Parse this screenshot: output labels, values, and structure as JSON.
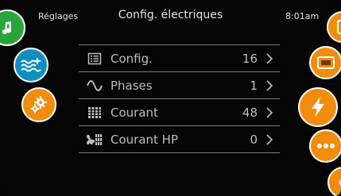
{
  "header": {
    "back_label": "Réglages",
    "title": "Config. électriques",
    "time": "8:01am"
  },
  "menu": {
    "items": [
      {
        "label": "Config.",
        "value": "16",
        "icon": "list-icon"
      },
      {
        "label": "Phases",
        "value": "1",
        "icon": "sine-wave-icon"
      },
      {
        "label": "Courant",
        "value": "48",
        "icon": "current-bars-icon"
      },
      {
        "label": "Courant HP",
        "value": "0",
        "icon": "fan-current-icon"
      }
    ]
  },
  "left_nav": [
    {
      "icon": "music-note-icon",
      "color": "#28a53a"
    },
    {
      "icon": "water-heat-icon",
      "color": "#0f8fc0"
    },
    {
      "icon": "gears-icon",
      "color": "#f28c0d"
    }
  ],
  "right_nav": [
    {
      "icon": "phone-icon",
      "color": "#f28c0d"
    },
    {
      "icon": "display-icon",
      "color": "#f28c0d"
    },
    {
      "icon": "lightning-icon",
      "color": "#f28c0d"
    },
    {
      "icon": "more-icon",
      "color": "#f28c0d"
    },
    {
      "icon": "partial-icon",
      "color": "#f28c0d"
    }
  ],
  "colors": {
    "background": "#050505",
    "text": "#e6e6e6",
    "muted_text": "#bdbdbd",
    "divider": "#7a7a7a",
    "accent_orange": "#f28c0d",
    "accent_blue": "#0f8fc0",
    "accent_green": "#28a53a"
  }
}
